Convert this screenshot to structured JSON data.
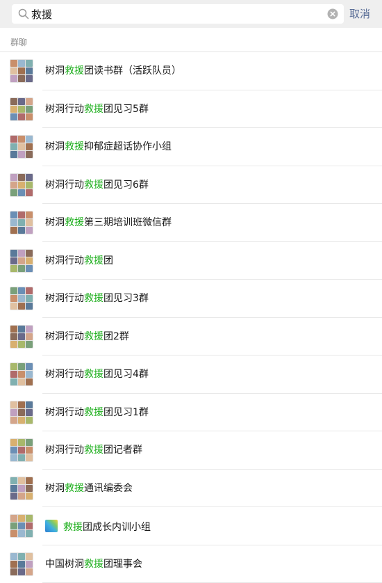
{
  "search": {
    "query": "救援",
    "cancel_label": "取消"
  },
  "section": {
    "label": "群聊"
  },
  "colors": {
    "highlight": "#1aad19",
    "cancel": "#576b95",
    "section_bg": "#efefef"
  },
  "groups": [
    {
      "pre": "树洞",
      "hl": "救援",
      "post": "团读书群（活跃队员）"
    },
    {
      "pre": "树洞行动",
      "hl": "救援",
      "post": "团见习5群"
    },
    {
      "pre": "树洞",
      "hl": "救援",
      "post": "抑郁症超话协作小组"
    },
    {
      "pre": "树洞行动",
      "hl": "救援",
      "post": "团见习6群"
    },
    {
      "pre": "树洞",
      "hl": "救援",
      "post": "第三期培训班微信群"
    },
    {
      "pre": "树洞行动",
      "hl": "救援",
      "post": "团"
    },
    {
      "pre": "树洞行动",
      "hl": "救援",
      "post": "团见习3群"
    },
    {
      "pre": "树洞行动",
      "hl": "救援",
      "post": "团2群"
    },
    {
      "pre": "树洞行动",
      "hl": "救援",
      "post": "团见习4群"
    },
    {
      "pre": "树洞行动",
      "hl": "救援",
      "post": "团见习1群"
    },
    {
      "pre": "树洞行动",
      "hl": "救援",
      "post": "团记者群"
    },
    {
      "pre": "树洞",
      "hl": "救援",
      "post": "通讯编委会"
    },
    {
      "pre": "",
      "hl": "救援",
      "post": "团成长内训小组",
      "badge": "rainbow-badge-icon"
    },
    {
      "pre": "中国树洞",
      "hl": "救援",
      "post": "团理事会"
    }
  ]
}
